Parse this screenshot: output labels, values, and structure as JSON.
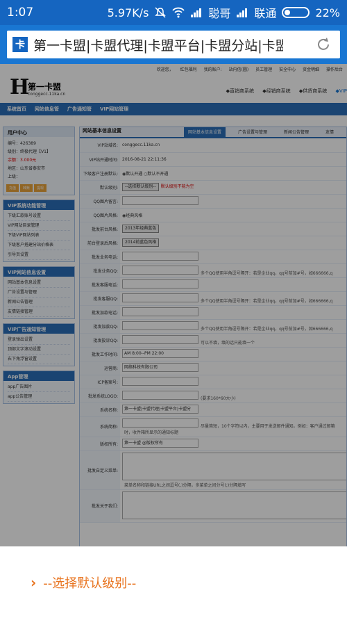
{
  "status": {
    "time": "1:07",
    "speed": "5.97K/s",
    "carrier1": "聪哥",
    "carrier2": "联通",
    "battery": "22%"
  },
  "browser": {
    "url_text": "第一卡盟|卡盟代理|卡盟平台|卡盟分站|卡盟"
  },
  "site": {
    "top_links": [
      "欢迎您，",
      "红包福利",
      "我的账户:",
      "站内信(圆)",
      "员工管理",
      "安全中心",
      "资金明细",
      "操作后台"
    ],
    "logo_title": "第一卡盟",
    "logo_url": "conggecc.11ka.cn",
    "sys_menu": [
      "◆直销商系统",
      "◆经销商系统",
      "◆供货商系统",
      "◆VIP"
    ],
    "main_nav": [
      "系统首页",
      "网站信息管",
      "广告通知管",
      "VIP网站管理"
    ]
  },
  "sidebar": {
    "user_center": "用户中心",
    "user_info": [
      "编号：426389",
      "级别：终极代理【V1】",
      "余额：3.000元",
      "地区：山东省泰安市",
      "上级："
    ],
    "user_buttons": [
      "充值",
      "转账",
      "提现"
    ],
    "sections": [
      {
        "title": "VIP系统功能管理",
        "items": [
          "下级汇款账号设置",
          "VIP网站目录管理",
          "下级VIP网站列表",
          "下级客户搭建分站价格表",
          "引导页设置"
        ]
      },
      {
        "title": "VIP网站信息设置",
        "items": [
          "网站基本信息设置",
          "广告设置与管理",
          "新闻公告管理",
          "友情链接管理"
        ]
      },
      {
        "title": "VIP广告通知管理",
        "items": [
          "登录弹出设置",
          "顶部文字滚动设置",
          "右下角浮窗设置"
        ]
      },
      {
        "title": "App管理",
        "items": [
          "app广告图片",
          "app公告管理"
        ]
      }
    ]
  },
  "content": {
    "title": "网站基本信息设置",
    "tabs": [
      "网站基本信息设置",
      "广告设置与管理",
      "新闻公告管理",
      "友情"
    ],
    "rows": [
      {
        "label": "VIP站域名:",
        "value": "conggecc.11ka.cn"
      },
      {
        "label": "VIP站开通时间:",
        "value": "2016-08-21 22:11:36"
      },
      {
        "label": "下级客户注册默认:",
        "value": "◉默认开通 ○默认不开通"
      },
      {
        "label": "默认级别:",
        "select": "--选择默认级别--",
        "hint_red": "默认级别不能为空"
      },
      {
        "label": "QQ图片留言:",
        "input": ""
      },
      {
        "label": "QQ图片风格:",
        "value": "◉经典风格"
      },
      {
        "label": "批发前台风格:",
        "select": "2013年经典蓝色"
      },
      {
        "label": "前台登录后风格:",
        "select": "2014前蓝色风格"
      },
      {
        "label": "批发业务电话:",
        "input": ""
      },
      {
        "label": "批发业务QQ:",
        "input": "",
        "hint": "多个QQ使用半角逗号隔开：若是企业qq，qq号前加#号，如666666,q"
      },
      {
        "label": "批发客服电话:",
        "input": ""
      },
      {
        "label": "批发客服QQ:",
        "input": "",
        "hint": "多个QQ使用半角逗号隔开：若是企业qq，qq号前加#号，如666666,q"
      },
      {
        "label": "批发加款电话:",
        "input": ""
      },
      {
        "label": "批发加款QQ:",
        "input": "",
        "hint": "多个QQ使用半角逗号隔开：若是企业qq，qq号前加#号，如666666,q"
      },
      {
        "label": "批发投诉QQ:",
        "input": "",
        "hint": "可以不填，填的话只能填一个"
      },
      {
        "label": "批发工作时间:",
        "input": "AM 8:00--PM 22:00"
      },
      {
        "label": "运营商:",
        "input": "网络科技有限公司"
      },
      {
        "label": "ICP备案号:",
        "input": ""
      },
      {
        "label": "批发系统LOGO:",
        "input": "",
        "hint": "(要求160*60大小)"
      },
      {
        "label": "系统名称:",
        "input": "第一卡盟|卡盟代理|卡盟平台|卡盟分"
      },
      {
        "label": "系统简称:",
        "input": "",
        "hint": "尽量简短，10个字符以内，主要用于发送邮件通知。例如：客户通过邮箱",
        "hint2": "时，收件箱所显示的通知标题"
      },
      {
        "label": "版权所有:",
        "input": "第一卡盟 @版权所有"
      },
      {
        "label": "批发自定义菜单:",
        "textarea": true,
        "hint": "菜单名称和链接URL之间逗号(,)分隔，多菜单之间分号(;)分隔填写"
      },
      {
        "label": "批发关于我们:",
        "textarea": true
      }
    ]
  },
  "popup": {
    "selected": "--选择默认级别--"
  }
}
